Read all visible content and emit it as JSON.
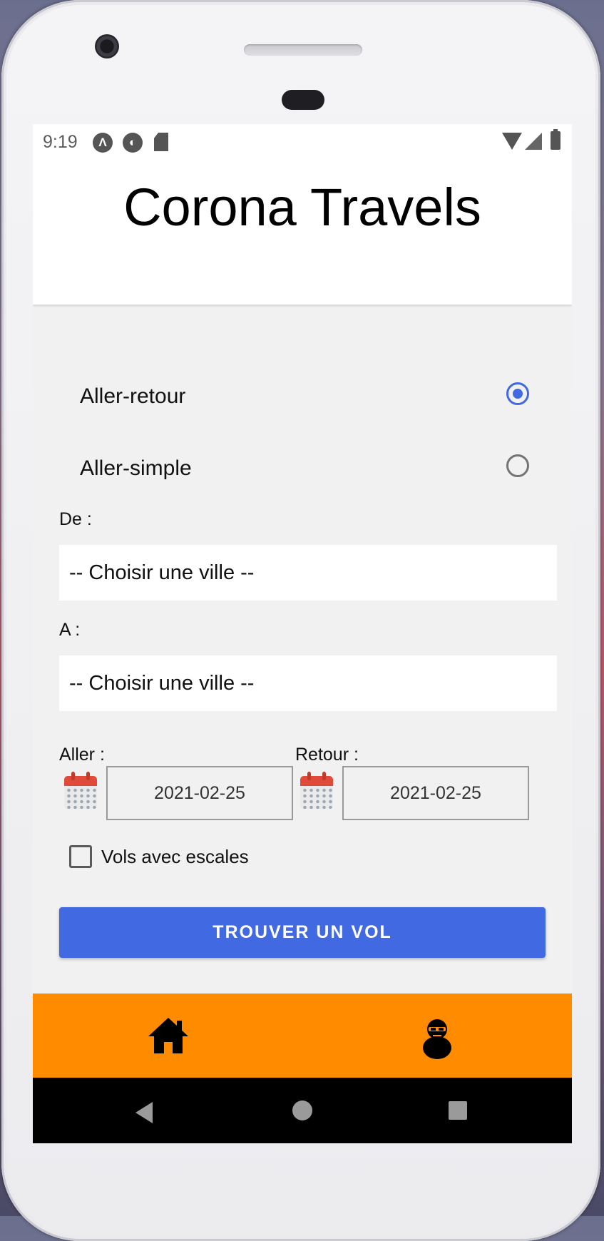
{
  "status_bar": {
    "time": "9:19",
    "notification_icons": [
      "a-icon",
      "circle-icon",
      "sd-card-icon"
    ],
    "right_icons": [
      "wifi-icon",
      "signal-icon",
      "battery-icon"
    ]
  },
  "header": {
    "title": "Corona Travels"
  },
  "trip_type": {
    "options": [
      {
        "label": "Aller-retour",
        "selected": true
      },
      {
        "label": "Aller-simple",
        "selected": false
      }
    ]
  },
  "from": {
    "label": "De :",
    "value": "-- Choisir une ville --"
  },
  "to": {
    "label": "A :",
    "value": "-- Choisir une ville --"
  },
  "dates": {
    "departure_label": "Aller :",
    "departure_value": "2021-02-25",
    "return_label": "Retour :",
    "return_value": "2021-02-25"
  },
  "stopovers": {
    "label": "Vols avec escales",
    "checked": false
  },
  "search_button": {
    "label": "TROUVER UN VOL"
  },
  "bottom_nav": {
    "items": [
      "home-icon",
      "profile-icon"
    ]
  },
  "colors": {
    "accent": "#4169e1",
    "nav_bar": "#ff8c00",
    "screen_bg": "#f1f1f1"
  }
}
